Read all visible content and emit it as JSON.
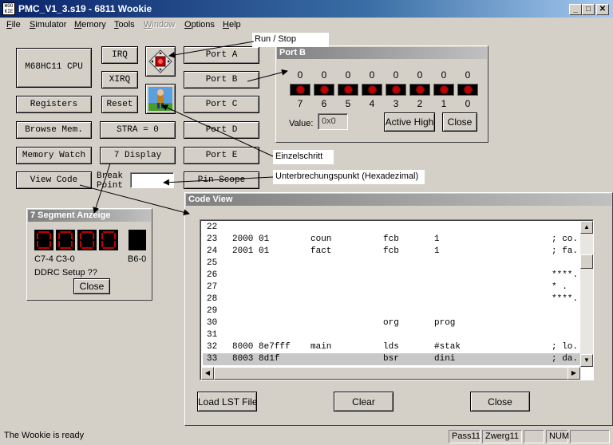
{
  "window": {
    "title": "PMC_V1_3.s19 - 6811 Wookie",
    "icon_text": "WOO KIE",
    "minimize": "_",
    "maximize": "□",
    "close": "✕"
  },
  "menu": [
    {
      "label": "File",
      "acc": "F",
      "rest": "ile",
      "enabled": true
    },
    {
      "label": "Simulator",
      "acc": "S",
      "rest": "imulator",
      "enabled": true
    },
    {
      "label": "Memory",
      "acc": "M",
      "rest": "emory",
      "enabled": true
    },
    {
      "label": "Tools",
      "acc": "T",
      "rest": "ools",
      "enabled": true
    },
    {
      "label": "Window",
      "acc": "W",
      "rest": "indow",
      "enabled": false
    },
    {
      "label": "Options",
      "acc": "O",
      "rest": "ptions",
      "enabled": true
    },
    {
      "label": "Help",
      "acc": "H",
      "rest": "elp",
      "enabled": true
    }
  ],
  "buttons": {
    "cpu": "M68HC11 CPU",
    "irq": "IRQ",
    "xirq": "XIRQ",
    "reset": "Reset",
    "registers": "Registers",
    "browse_mem": "Browse Mem.",
    "stra": "STRA = 0",
    "memory_watch": "Memory Watch",
    "display": "7 Display",
    "view_code": "View Code",
    "break_point": "Break Point",
    "port_a": "Port A",
    "port_b": "Port B",
    "port_c": "Port C",
    "port_d": "Port D",
    "port_e": "Port E",
    "pin_scope": "Pin Scope"
  },
  "icons": {
    "run_stop": "run-stop-icon",
    "single_step": "single-step-icon"
  },
  "port_b": {
    "title": "Port B",
    "values": [
      "0",
      "0",
      "0",
      "0",
      "0",
      "0",
      "0",
      "0"
    ],
    "bits": [
      "7",
      "6",
      "5",
      "4",
      "3",
      "2",
      "1",
      "0"
    ],
    "value_label": "Value:",
    "value": "0x0",
    "active_high": "Active High",
    "close": "Close"
  },
  "seven_segment": {
    "title": "7 Segment Anzeige",
    "label_left": "C7-4 C3-0",
    "label_right": "B6-0",
    "ddrc": "DDRC Setup ??",
    "close": "Close"
  },
  "code_view": {
    "title": "Code View",
    "lines": [
      {
        "n": "22",
        "addr": "",
        "op": "",
        "label": "",
        "mnem": "",
        "arg": "",
        "comment": "",
        "hl": false
      },
      {
        "n": "23",
        "addr": "2000",
        "op": "01",
        "label": "coun",
        "mnem": "fcb",
        "arg": "1",
        "comment": "; co.",
        "hl": false
      },
      {
        "n": "24",
        "addr": "2001",
        "op": "01",
        "label": "fact",
        "mnem": "fcb",
        "arg": "1",
        "comment": "; fa.",
        "hl": false
      },
      {
        "n": "25",
        "addr": "",
        "op": "",
        "label": "",
        "mnem": "",
        "arg": "",
        "comment": "",
        "hl": false
      },
      {
        "n": "26",
        "addr": "",
        "op": "",
        "label": "",
        "mnem": "",
        "arg": "",
        "comment": "****.",
        "hl": false
      },
      {
        "n": "27",
        "addr": "",
        "op": "",
        "label": "",
        "mnem": "",
        "arg": "",
        "comment": "*   .",
        "hl": false
      },
      {
        "n": "28",
        "addr": "",
        "op": "",
        "label": "",
        "mnem": "",
        "arg": "",
        "comment": "****.",
        "hl": false
      },
      {
        "n": "29",
        "addr": "",
        "op": "",
        "label": "",
        "mnem": "",
        "arg": "",
        "comment": "",
        "hl": false
      },
      {
        "n": "30",
        "addr": "",
        "op": "",
        "label": "",
        "mnem": "org",
        "arg": "prog",
        "comment": "",
        "hl": false
      },
      {
        "n": "31",
        "addr": "",
        "op": "",
        "label": "",
        "mnem": "",
        "arg": "",
        "comment": "",
        "hl": false
      },
      {
        "n": "32",
        "addr": "8000",
        "op": "8e7fff",
        "label": "main",
        "mnem": "lds",
        "arg": "#stak",
        "comment": "; lo.",
        "hl": false
      },
      {
        "n": "33",
        "addr": "8003",
        "op": "8d1f",
        "label": "",
        "mnem": "bsr",
        "arg": "dini",
        "comment": "; da.",
        "hl": true
      }
    ],
    "load_lst": "Load LST File",
    "clear": "Clear",
    "close": "Close"
  },
  "callouts": {
    "run_stop": "Run / Stop",
    "single_step": "Einzelschritt",
    "breakpoint": "Unterbrechungspunkt (Hexadezimal)"
  },
  "status": {
    "message": "The Wookie is ready",
    "pass": "Pass11",
    "zwerg": "Zwerg11",
    "blank": "",
    "num": "NUM"
  },
  "colors": {
    "title_active": "#0a246a",
    "panel_title": "#808080",
    "led_on": "#c00000",
    "face": "#d4d0c8"
  }
}
